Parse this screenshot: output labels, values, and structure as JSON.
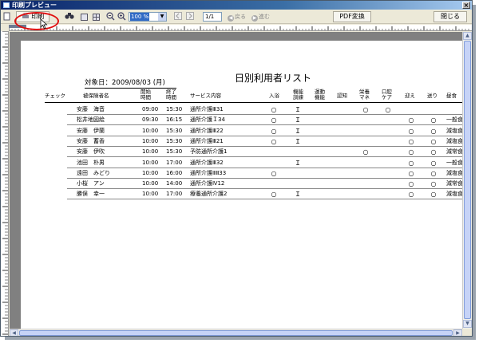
{
  "window": {
    "title": "印刷プレビュー",
    "close_glyph": "×"
  },
  "toolbar": {
    "print_label": "印刷",
    "zoom_value": "100 %",
    "page_value": "1/1",
    "back_label": "戻る",
    "next_label": "進む",
    "pdf_label": "PDF変換",
    "close_label": "閉じる"
  },
  "icons": {
    "binoculars": "binoculars-icon",
    "single_page": "single-page-icon",
    "multi_page": "multi-page-icon",
    "zoom_out": "zoom-out-icon",
    "zoom_in": "zoom-in-icon"
  },
  "report": {
    "date_label": "対象日：2009/08/03 (月)",
    "title": "日別利用者リスト",
    "headers": {
      "check": "チェック",
      "name": "被保険者名",
      "start": [
        "開始",
        "時間"
      ],
      "end": [
        "終了",
        "時間"
      ],
      "service": "サービス内容",
      "bath": "入浴",
      "func_train": [
        "機能",
        "訓練"
      ],
      "exercise": [
        "運動",
        "機能"
      ],
      "cognition": "認知",
      "nutrition": [
        "栄養",
        "マネ"
      ],
      "oral": [
        "口腔",
        "ケア"
      ],
      "pickup": "迎え",
      "dropoff": "送り",
      "meal": "昼食"
    },
    "rows": [
      {
        "name": "安藤　海音",
        "start": "09:00",
        "end": "15:30",
        "service": "通所介護Ⅲ31",
        "bath": "○",
        "func": "Ｉ",
        "nutrition": "○",
        "oral": "○",
        "pickup": "",
        "dropoff": "",
        "meal": ""
      },
      {
        "name": "松井地図絵",
        "start": "09:30",
        "end": "16:15",
        "service": "通所介護Ｉ34",
        "bath": "○",
        "func": "Ｉ",
        "nutrition": "",
        "oral": "",
        "pickup": "○",
        "dropoff": "○",
        "meal": "一般食"
      },
      {
        "name": "安藤　伊蘭",
        "start": "10:00",
        "end": "15:30",
        "service": "通所介護Ⅲ22",
        "bath": "○",
        "func": "Ｉ",
        "nutrition": "",
        "oral": "",
        "pickup": "○",
        "dropoff": "○",
        "meal": "減塩食"
      },
      {
        "name": "安藤　蓄香",
        "start": "10:00",
        "end": "15:30",
        "service": "通所介護Ⅲ21",
        "bath": "○",
        "func": "Ｉ",
        "nutrition": "",
        "oral": "",
        "pickup": "○",
        "dropoff": "○",
        "meal": "減塩食"
      },
      {
        "name": "安藤　伊吹",
        "start": "10:00",
        "end": "15:30",
        "service": "予防通所介護1",
        "bath": "",
        "func": "",
        "nutrition": "○",
        "oral": "",
        "pickup": "○",
        "dropoff": "○",
        "meal": "減常食"
      },
      {
        "name": "池田　朴男",
        "start": "10:00",
        "end": "17:00",
        "service": "通所介護Ⅲ32",
        "bath": "",
        "func": "Ｉ",
        "nutrition": "",
        "oral": "",
        "pickup": "○",
        "dropoff": "○",
        "meal": "一般食"
      },
      {
        "name": "遠田　みどり",
        "start": "10:00",
        "end": "16:00",
        "service": "通所介護ⅡⅢ33",
        "bath": "○",
        "func": "",
        "nutrition": "",
        "oral": "",
        "pickup": "○",
        "dropoff": "○",
        "meal": "減塩食"
      },
      {
        "name": "小桜　アン",
        "start": "10:00",
        "end": "14:00",
        "service": "通所介護Ⅳ12",
        "bath": "",
        "func": "",
        "nutrition": "",
        "oral": "",
        "pickup": "○",
        "dropoff": "○",
        "meal": "減常食"
      },
      {
        "name": "勝俣　幸一",
        "start": "10:00",
        "end": "17:00",
        "service": "療養通所介護2",
        "bath": "○",
        "func": "Ｉ",
        "nutrition": "",
        "oral": "",
        "pickup": "○",
        "dropoff": "○",
        "meal": "減塩食"
      }
    ]
  }
}
